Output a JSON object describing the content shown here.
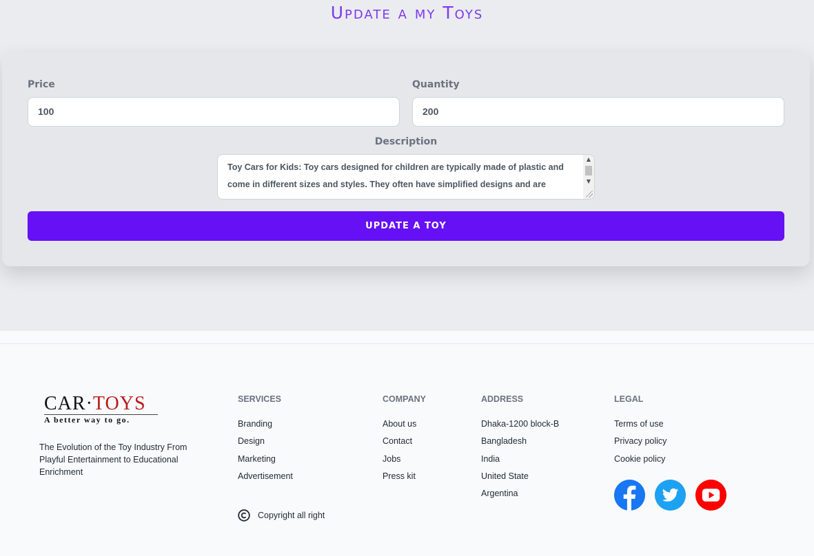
{
  "page": {
    "title": "Update a my Toys"
  },
  "form": {
    "price_label": "Price",
    "price_value": "100",
    "quantity_label": "Quantity",
    "quantity_value": "200",
    "description_label": "Description",
    "description_value": "Toy Cars for Kids: Toy cars designed for children are typically made of plastic and come in different sizes and styles. They often have simplified designs and are",
    "submit_label": "UPDATE A TOY"
  },
  "footer": {
    "logo": {
      "brand_left": "CAR",
      "brand_sep": "·",
      "brand_right": "TOYS",
      "tagline": "A better way to go."
    },
    "about": "The Evolution of the Toy Industry From Playful Entertainment to Educational Enrichment",
    "services": {
      "heading": "SERVICES",
      "items": [
        "Branding",
        "Design",
        "Marketing",
        "Advertisement"
      ]
    },
    "company": {
      "heading": "COMPANY",
      "items": [
        "About us",
        "Contact",
        "Jobs",
        "Press kit"
      ]
    },
    "address": {
      "heading": "ADDRESS",
      "items": [
        "Dhaka-1200 block-B",
        "Bangladesh",
        "India",
        "United State",
        "Argentina"
      ]
    },
    "legal": {
      "heading": "LEGAL",
      "items": [
        "Terms of use",
        "Privacy policy",
        "Cookie policy"
      ]
    },
    "copyright": "Copyright all right",
    "social": [
      "facebook-icon",
      "twitter-icon",
      "youtube-icon"
    ]
  },
  "colors": {
    "accent": "#6610f5",
    "title": "#7c3aed",
    "facebook": "#1877f2",
    "twitter": "#1da1f2",
    "youtube": "#ff0000",
    "logo_red": "#b91c1c"
  }
}
